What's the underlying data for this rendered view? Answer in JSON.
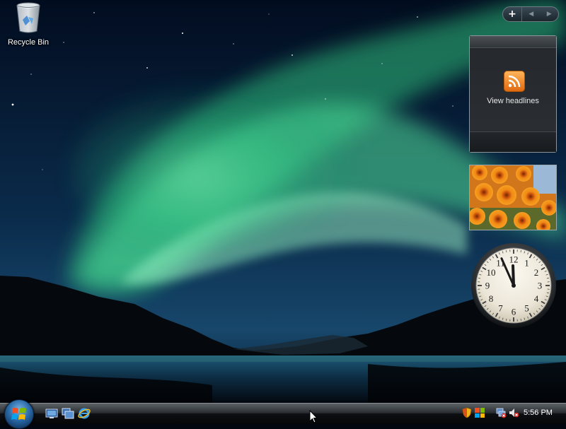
{
  "desktop": {
    "icons": [
      {
        "label": "Recycle Bin",
        "icon": "recycle-bin-icon"
      }
    ]
  },
  "sidebar": {
    "controls": {
      "add": "+",
      "prev": "◀",
      "next": "▶"
    }
  },
  "gadgets": {
    "feed": {
      "title": "View headlines",
      "icon": "rss-icon",
      "accent": "#f08a24"
    },
    "slideshow": {
      "subject": "orange flowers"
    },
    "clock": {
      "hour": 11,
      "minute": 56,
      "numerals": [
        "12",
        "1",
        "2",
        "3",
        "4",
        "5",
        "6",
        "7",
        "8",
        "9",
        "10",
        "11"
      ]
    }
  },
  "taskbar": {
    "start_icon": "windows-logo-icon",
    "quick_launch": [
      {
        "icon": "show-desktop-icon"
      },
      {
        "icon": "switch-windows-icon"
      },
      {
        "icon": "internet-explorer-icon"
      }
    ],
    "tray_icons": [
      "shield-icon",
      "network-icon",
      "network-disconnected-icon",
      "volume-muted-icon"
    ],
    "clock": "5:56 PM"
  }
}
